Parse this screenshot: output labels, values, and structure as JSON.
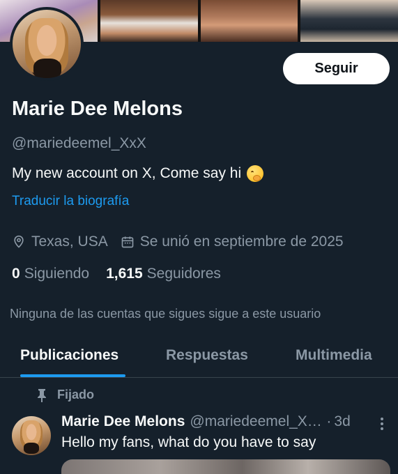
{
  "profile": {
    "display_name": "Marie Dee Melons",
    "handle": "@mariedeemel_XxX",
    "bio": "My new account on X, Come say hi",
    "translate_label": "Traducir la biografía",
    "follow_label": "Seguir",
    "location": "Texas, USA",
    "joined": "Se unió en septiembre de 2025",
    "following_count": "0",
    "following_label": "Siguiendo",
    "followers_count": "1,615",
    "followers_label": "Seguidores",
    "no_mutual_text": "Ninguna de las cuentas que sigues sigue a este usuario"
  },
  "tabs": [
    {
      "label": "Publicaciones",
      "active": true
    },
    {
      "label": "Respuestas",
      "active": false
    },
    {
      "label": "Multimedia",
      "active": false
    }
  ],
  "post": {
    "pinned_label": "Fijado",
    "author_name": "Marie Dee Melons",
    "author_handle": "@mariedeemel_XxX",
    "dot": "·",
    "time": "3d",
    "text": "Hello my fans, what do you have to say"
  },
  "icons": {
    "location": "map-pin-icon",
    "calendar": "calendar-icon",
    "pin": "pin-icon",
    "more": "more-vertical-icon",
    "emoji": "face-with-hand-over-mouth-emoji"
  },
  "colors": {
    "background": "#15202b",
    "text_primary": "#f7f9f9",
    "text_secondary": "#8b98a5",
    "accent": "#1d9bf0",
    "follow_button_bg": "#ffffff"
  }
}
